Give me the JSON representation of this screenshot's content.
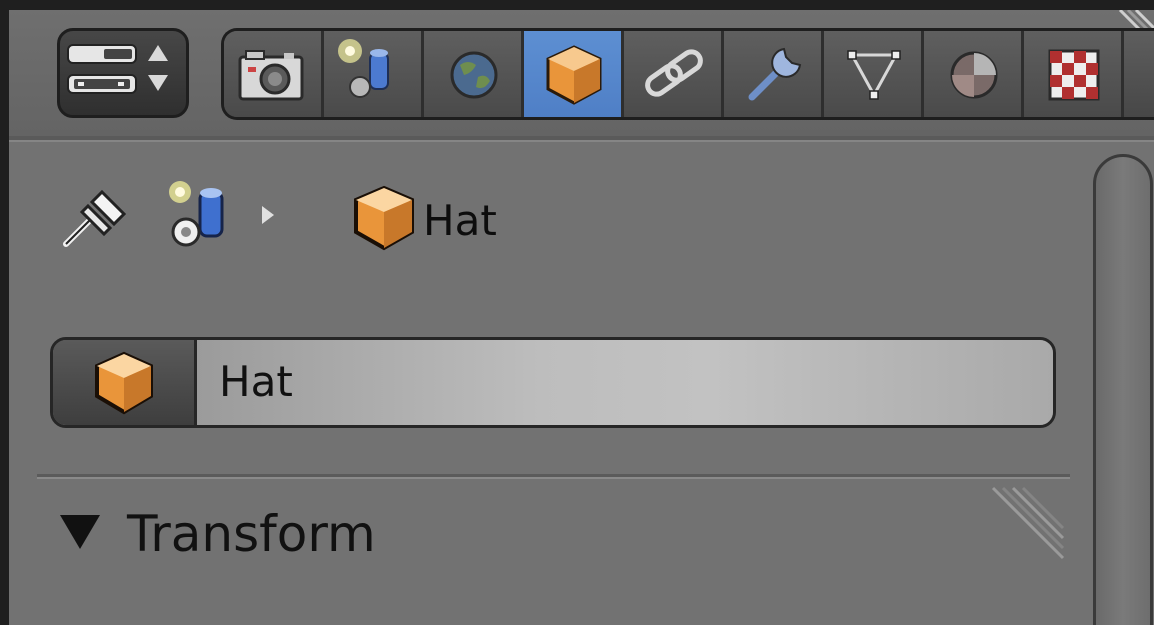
{
  "header": {
    "view_toggle_icon": "view-toggle-icon",
    "tabs": [
      {
        "name": "render",
        "icon": "camera-icon",
        "active": false
      },
      {
        "name": "scene",
        "icon": "scene-icon",
        "active": false
      },
      {
        "name": "world",
        "icon": "world-icon",
        "active": false
      },
      {
        "name": "object",
        "icon": "object-cube-icon",
        "active": true
      },
      {
        "name": "constraints",
        "icon": "chain-link-icon",
        "active": false
      },
      {
        "name": "modifiers",
        "icon": "wrench-icon",
        "active": false
      },
      {
        "name": "data",
        "icon": "mesh-triangle-icon",
        "active": false
      },
      {
        "name": "material",
        "icon": "material-sphere-icon",
        "active": false
      },
      {
        "name": "texture",
        "icon": "checker-texture-icon",
        "active": false
      }
    ]
  },
  "breadcrumb": {
    "pin_icon": "pin-icon",
    "scene_icon": "scene-icon",
    "separator_icon": "chevron-right-icon",
    "object_icon": "object-cube-icon",
    "label": "Hat"
  },
  "name_field": {
    "icon": "object-cube-icon",
    "value": "Hat"
  },
  "panel": {
    "title": "Transform",
    "expanded": true
  },
  "colors": {
    "active_tab": "#5b8bd0",
    "cube_orange": "#e8953a",
    "background": "#727272"
  }
}
